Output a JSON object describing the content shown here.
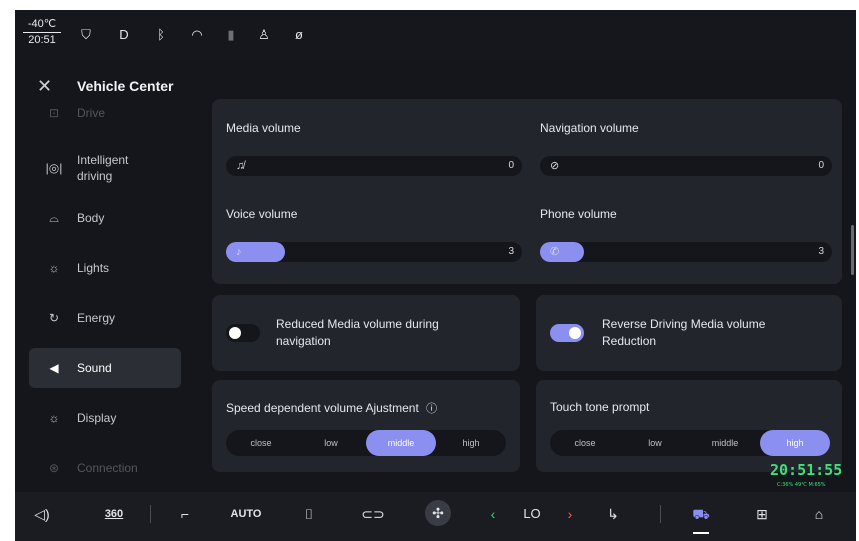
{
  "status": {
    "temperature": "-40℃",
    "time": "20:51",
    "icons": [
      "shield-icon",
      "headlight-icon",
      "bluetooth-icon",
      "wifi-icon",
      "signal-icon",
      "user-icon",
      "eye-off-icon"
    ]
  },
  "header": {
    "title": "Vehicle Center"
  },
  "sidebar": {
    "items": [
      {
        "label": "Drive",
        "icon": "drive-icon"
      },
      {
        "label": "Intelligent driving",
        "icon": "intelligent-driving-icon"
      },
      {
        "label": "Body",
        "icon": "car-body-icon"
      },
      {
        "label": "Lights",
        "icon": "lights-icon"
      },
      {
        "label": "Energy",
        "icon": "energy-icon"
      },
      {
        "label": "Sound",
        "icon": "speaker-icon"
      },
      {
        "label": "Display",
        "icon": "display-icon"
      },
      {
        "label": "Connection",
        "icon": "connection-icon"
      }
    ],
    "active": "Sound"
  },
  "volumes": {
    "media": {
      "label": "Media volume",
      "value": "0",
      "level": 0
    },
    "navigation": {
      "label": "Navigation volume",
      "value": "0",
      "level": 0
    },
    "voice": {
      "label": "Voice volume",
      "value": "3",
      "level": 0.2
    },
    "phone": {
      "label": "Phone volume",
      "value": "3",
      "level": 0.15
    }
  },
  "toggles": {
    "reduced_media": {
      "label": "Reduced Media volume during navigation",
      "on": false
    },
    "reverse_driving": {
      "label": "Reverse Driving Media volume Reduction",
      "on": true
    }
  },
  "speed_volume": {
    "label": "Speed dependent volume Ajustment",
    "info_icon": "info-icon",
    "options": [
      "close",
      "low",
      "middle",
      "high"
    ],
    "selected": "middle"
  },
  "touch_tone": {
    "label": "Touch tone prompt",
    "options": [
      "close",
      "low",
      "middle",
      "high"
    ],
    "selected": "high"
  },
  "clock_overlay": {
    "time": "20:51:55",
    "sub": "C:36% 49℃ M:65%"
  },
  "dock": {
    "view360": "360",
    "auto": "AUTO",
    "fan_level": "LO",
    "accent": "#8b8ff0",
    "items": [
      "volume-icon",
      "360-view-icon",
      "seat-icon",
      "auto-ac",
      "rear-defrost-icon",
      "recirculation-icon",
      "fan-icon",
      "chevron-left-icon",
      "fan-level",
      "chevron-right-icon",
      "seat-heat-icon",
      "vehicle-icon",
      "apps-icon",
      "home-icon"
    ]
  }
}
